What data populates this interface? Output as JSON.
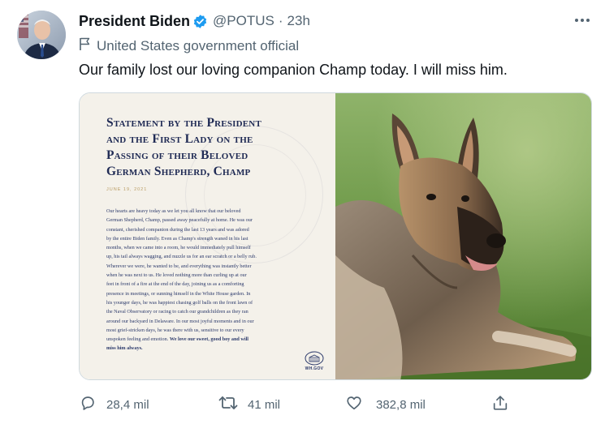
{
  "author": {
    "name": "President Biden",
    "handle": "@POTUS",
    "separator": "·",
    "time": "23h",
    "label": "United States government official",
    "avatar_icon": "avatar-portrait"
  },
  "tweet": {
    "text": "Our family lost our loving companion Champ today. I will miss him."
  },
  "statement": {
    "title_lines": [
      "Statement by the President",
      "and the First Lady on the",
      "Passing of their Beloved",
      "German Shepherd, Champ"
    ],
    "date": "JUNE 19, 2021",
    "body_lines": [
      "Our hearts are heavy today as we let you all know that our beloved",
      "German Shepherd, Champ, passed away peacefully at home. He was our",
      "constant, cherished companion during the last 13 years and was adored",
      "by the entire Biden family. Even as Champ's strength waned in his last",
      "months, when we came into a room, he would immediately pull himself",
      "up, his tail always wagging, and nuzzle us for an ear scratch or a belly rub.",
      "Wherever we were, he wanted to be, and everything was instantly better",
      "when he was next to us. He loved nothing more than curling up at our",
      "feet in front of a fire at the end of the day, joining us as a comforting",
      "presence in meetings, or sunning himself in the White House garden. In",
      "his younger days, he was happiest chasing golf balls on the front lawn of",
      "the Naval Observatory or racing to catch our grandchildren as they ran",
      "around our backyard in Delaware. In our most joyful moments and in our",
      "most grief-stricken days, he was there with us, sensitive to our every"
    ],
    "body_last_plain": "unspoken feeling and emotion. ",
    "body_last_bold": "We love our sweet, good boy and will",
    "body_final_bold": "miss him always.",
    "logo_label": "WH.GOV"
  },
  "actions": {
    "replies": "28,4 mil",
    "retweets": "41 mil",
    "likes": "382,8 mil"
  },
  "colors": {
    "verified": "#1d9bf0",
    "secondary_text": "#536471",
    "statement_navy": "#202b55"
  }
}
